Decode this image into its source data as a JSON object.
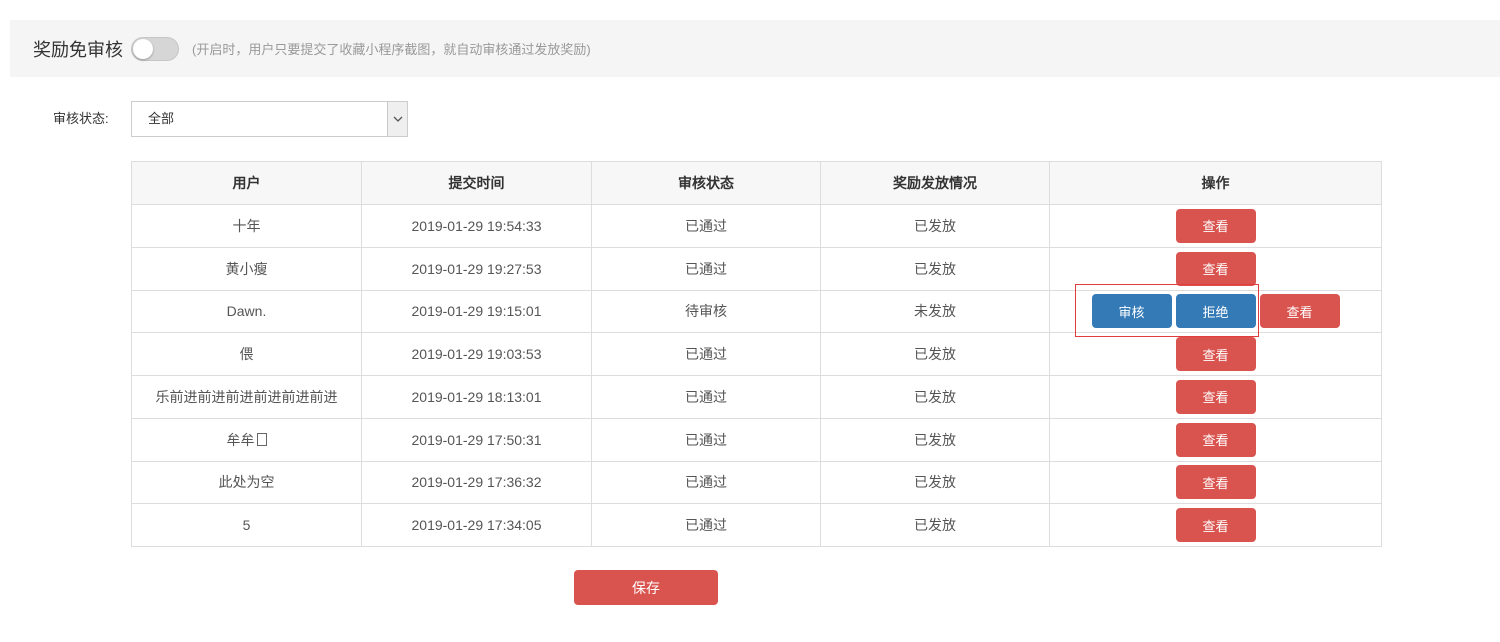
{
  "header": {
    "title": "奖励免审核",
    "toggle_on": false,
    "description": "(开启时，用户只要提交了收藏小程序截图，就自动审核通过发放奖励)"
  },
  "filter": {
    "label": "审核状态:",
    "selected": "全部"
  },
  "table": {
    "columns": [
      "用户",
      "提交时间",
      "审核状态",
      "奖励发放情况",
      "操作"
    ],
    "rows": [
      {
        "user": "十年",
        "time": "2019-01-29 19:54:33",
        "status": "已通过",
        "reward": "已发放",
        "actions": [
          {
            "label": "查看",
            "color": "#d9534f"
          }
        ]
      },
      {
        "user": "黄小瘦",
        "time": "2019-01-29 19:27:53",
        "status": "已通过",
        "reward": "已发放",
        "actions": [
          {
            "label": "查看",
            "color": "#d9534f"
          }
        ]
      },
      {
        "user": "Dawn.",
        "time": "2019-01-29 19:15:01",
        "status": "待审核",
        "reward": "未发放",
        "actions": [
          {
            "label": "审核",
            "color": "#337ab7"
          },
          {
            "label": "拒绝",
            "color": "#337ab7"
          },
          {
            "label": "查看",
            "color": "#d9534f"
          }
        ]
      },
      {
        "user": "偎",
        "time": "2019-01-29 19:03:53",
        "status": "已通过",
        "reward": "已发放",
        "actions": [
          {
            "label": "查看",
            "color": "#d9534f"
          }
        ]
      },
      {
        "user": "乐前进前进前进前进前进前进",
        "time": "2019-01-29 18:13:01",
        "status": "已通过",
        "reward": "已发放",
        "actions": [
          {
            "label": "查看",
            "color": "#d9534f"
          }
        ]
      },
      {
        "user": "牟牟",
        "icon": "missing-glyph-icon",
        "time": "2019-01-29 17:50:31",
        "status": "已通过",
        "reward": "已发放",
        "actions": [
          {
            "label": "查看",
            "color": "#d9534f"
          }
        ]
      },
      {
        "user": "此处为空",
        "time": "2019-01-29 17:36:32",
        "status": "已通过",
        "reward": "已发放",
        "actions": [
          {
            "label": "查看",
            "color": "#d9534f"
          }
        ]
      },
      {
        "user": "5",
        "time": "2019-01-29 17:34:05",
        "status": "已通过",
        "reward": "已发放",
        "actions": [
          {
            "label": "查看",
            "color": "#d9534f"
          }
        ]
      }
    ]
  },
  "footer": {
    "save_label": "保存"
  },
  "colors": {
    "danger": "#d9534f",
    "primary": "#337ab7",
    "toggle_on": "#5cb85c",
    "highlight": "#e23c3c"
  }
}
